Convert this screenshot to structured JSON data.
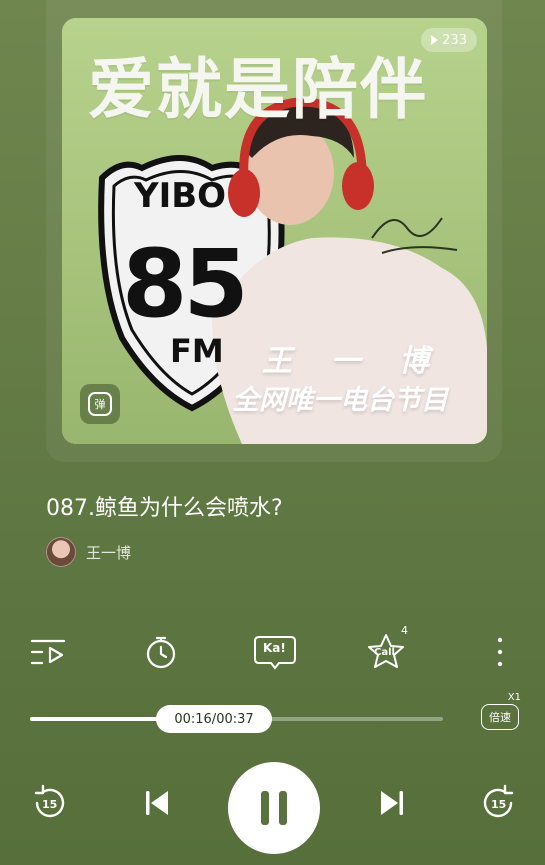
{
  "cover": {
    "play_count": "233",
    "title": "爱就是陪伴",
    "sign_top": "YIBO",
    "sign_number": "85",
    "sign_bottom": "FM",
    "host_name": "王 一 博",
    "tagline": "全网唯一电台节目",
    "danmu_label": "弹"
  },
  "track": {
    "title": "087.鲸鱼为什么会喷水?",
    "artist": "王一博"
  },
  "toolbar": {
    "karaoke_label": "Ka!",
    "call_label": "Call",
    "call_count": "4"
  },
  "progress": {
    "time": "00:16/00:37",
    "fraction": 0.43
  },
  "speed": {
    "label": "倍速",
    "value": "X1"
  },
  "controls": {
    "rewind_seconds": "15",
    "forward_seconds": "15"
  },
  "colors": {
    "background": "#667d47",
    "cover_bg": "#a8c47e"
  }
}
